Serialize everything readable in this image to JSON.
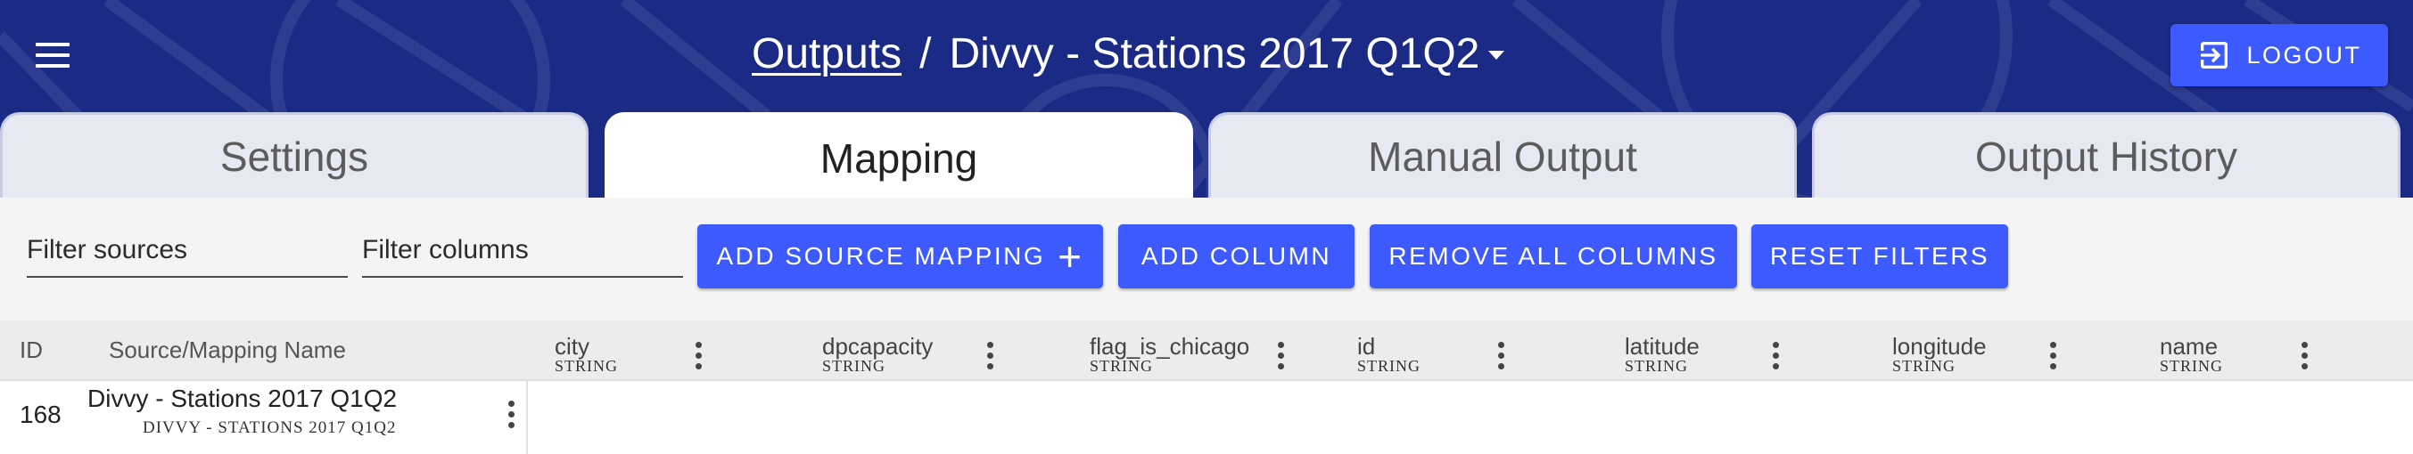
{
  "header": {
    "breadcrumb_link": "Outputs",
    "breadcrumb_separator": "/",
    "title": "Divvy - Stations 2017 Q1Q2",
    "logout_label": "LOGOUT"
  },
  "tabs": [
    {
      "label": "Settings",
      "active": false
    },
    {
      "label": "Mapping",
      "active": true
    },
    {
      "label": "Manual Output",
      "active": false
    },
    {
      "label": "Output History",
      "active": false
    }
  ],
  "toolbar": {
    "filter_sources_placeholder": "Filter sources",
    "filter_columns_placeholder": "Filter columns",
    "add_source_mapping_label": "ADD SOURCE MAPPING",
    "add_column_label": "ADD COLUMN",
    "remove_all_columns_label": "REMOVE ALL COLUMNS",
    "reset_filters_label": "RESET FILTERS"
  },
  "grid": {
    "id_header": "ID",
    "source_header": "Source/Mapping Name",
    "columns": [
      {
        "name": "city",
        "type": "STRING"
      },
      {
        "name": "dpcapacity",
        "type": "STRING"
      },
      {
        "name": "flag_is_chicago",
        "type": "STRING"
      },
      {
        "name": "id",
        "type": "STRING"
      },
      {
        "name": "latitude",
        "type": "STRING"
      },
      {
        "name": "longitude",
        "type": "STRING"
      },
      {
        "name": "name",
        "type": "STRING"
      }
    ],
    "rows": [
      {
        "id": "168",
        "name": "Divvy - Stations 2017 Q1Q2",
        "sub": "DIVVY - STATIONS 2017 Q1Q2"
      }
    ]
  },
  "colors": {
    "header_bg": "#1a2a85",
    "accent": "#3d5afe",
    "toolbar_bg": "#f4f4f4"
  },
  "icons": [
    "menu-icon",
    "dropdown-caret-icon",
    "logout-icon",
    "plus-icon",
    "more-vert-icon"
  ]
}
